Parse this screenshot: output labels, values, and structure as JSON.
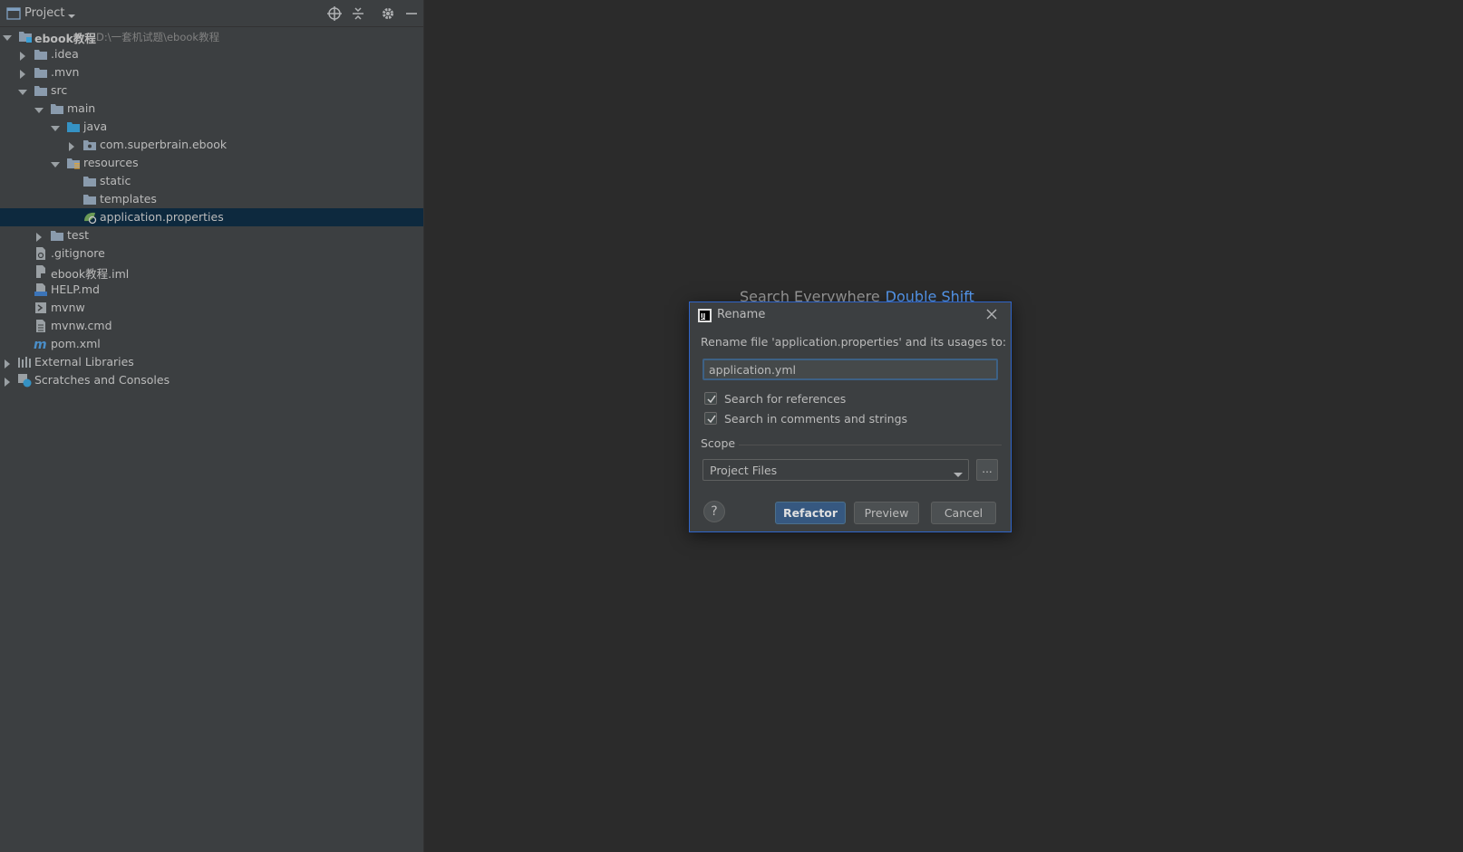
{
  "panel": {
    "title": "Project",
    "tree": [
      {
        "label": "ebook教程",
        "path": "D:\\一套机试题\\ebook教程",
        "icon": "project-module-icon"
      },
      {
        "label": ".idea",
        "icon": "folder-icon"
      },
      {
        "label": ".mvn",
        "icon": "folder-icon"
      },
      {
        "label": "src",
        "icon": "folder-icon"
      },
      {
        "label": "main",
        "icon": "folder-icon"
      },
      {
        "label": "java",
        "icon": "source-folder-icon"
      },
      {
        "label": "com.superbrain.ebook",
        "icon": "package-icon"
      },
      {
        "label": "resources",
        "icon": "resources-folder-icon"
      },
      {
        "label": "static",
        "icon": "folder-icon"
      },
      {
        "label": "templates",
        "icon": "folder-icon"
      },
      {
        "label": "application.properties",
        "icon": "spring-properties-icon"
      },
      {
        "label": "test",
        "icon": "folder-icon"
      },
      {
        "label": ".gitignore",
        "icon": "gitignore-file-icon"
      },
      {
        "label": "ebook教程.iml",
        "icon": "iml-file-icon"
      },
      {
        "label": "HELP.md",
        "icon": "markdown-file-icon"
      },
      {
        "label": "mvnw",
        "icon": "shell-script-icon"
      },
      {
        "label": "mvnw.cmd",
        "icon": "text-file-icon"
      },
      {
        "label": "pom.xml",
        "icon": "maven-icon"
      },
      {
        "label": "External Libraries",
        "icon": "libraries-icon"
      },
      {
        "label": "Scratches and Consoles",
        "icon": "scratches-icon"
      }
    ]
  },
  "editor": {
    "hint_text": "Search Everywhere",
    "hint_shortcut": "Double Shift"
  },
  "dialog": {
    "title": "Rename",
    "prompt": "Rename file 'application.properties' and its usages to:",
    "new_name": "application.yml",
    "search_references": "Search for references",
    "search_comments": "Search in comments and strings",
    "scope_label": "Scope",
    "scope_value": "Project Files",
    "more_label": "...",
    "help_label": "?",
    "refactor_label": "Refactor",
    "preview_label": "Preview",
    "cancel_label": "Cancel"
  },
  "colors": {
    "panel_bg": "#3c3f41",
    "editor_bg": "#2b2b2b",
    "selection": "#0d293e",
    "accent_button": "#365880",
    "link": "#589df6"
  }
}
